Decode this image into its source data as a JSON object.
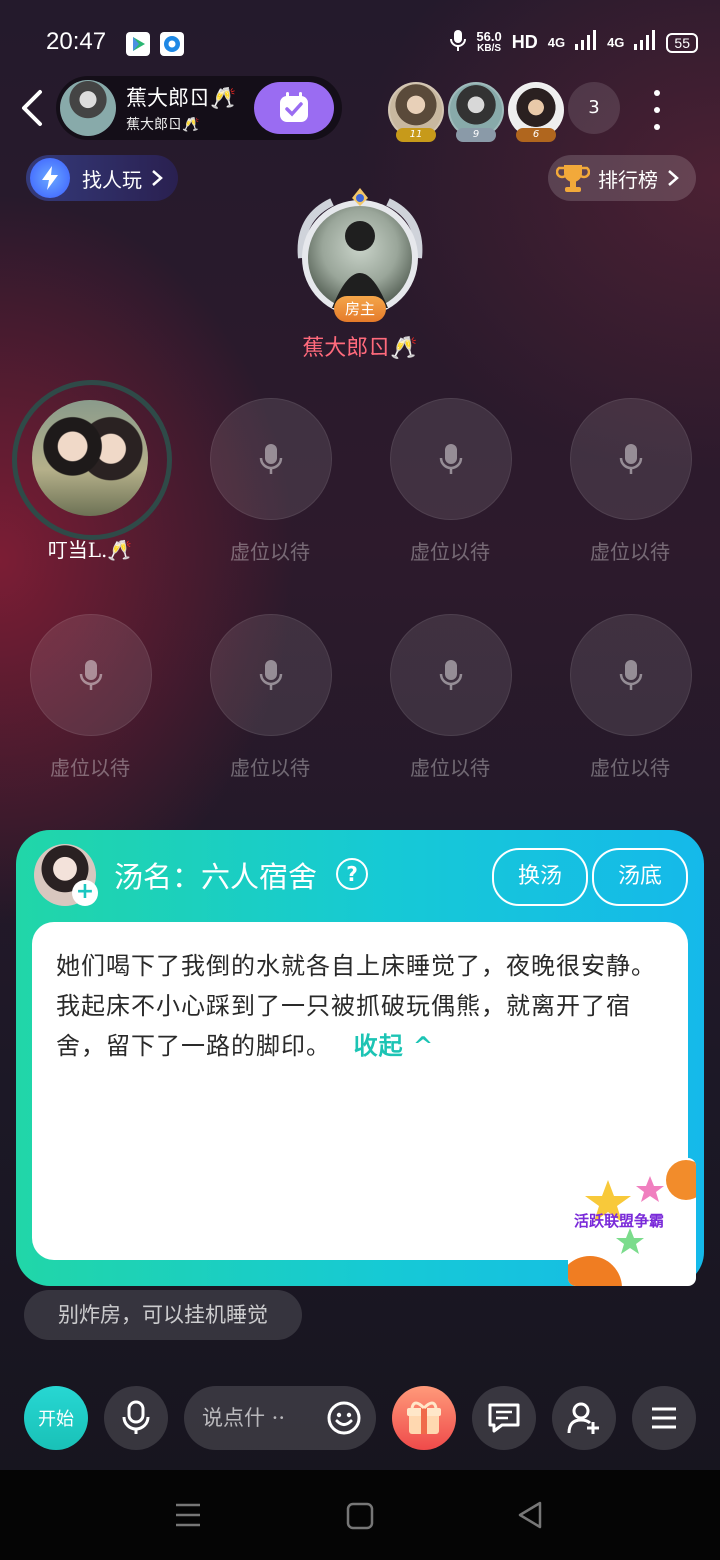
{
  "status_bar": {
    "time": "20:47",
    "net_speed_value": "56.0",
    "net_speed_unit": "KB/S",
    "hd": "HD",
    "network_1": "4G",
    "network_2": "4G",
    "battery": "55",
    "icons": [
      "app-video-icon",
      "app-browser-icon",
      "mic-icon",
      "wifi-icon",
      "signal-icon"
    ]
  },
  "header": {
    "host_name": "蕉大郎ㄖ🥂",
    "host_sub": "蕉大郎ㄖ🥂",
    "audience": [
      {
        "level": "11",
        "badge_color": "#c79a1a"
      },
      {
        "level": "9",
        "badge_color": "#8a9aa8"
      },
      {
        "level": "6",
        "badge_color": "#b0661e"
      }
    ],
    "audience_count": "3",
    "find_play_label": "找人玩",
    "ranking_label": "排行榜"
  },
  "host_seat": {
    "badge": "房主",
    "name": "蕉大郎ㄖ🥂"
  },
  "seats": {
    "occupied_name": "叮当L.🥂",
    "empty_label": "虚位以待"
  },
  "soup": {
    "title": "汤名：六人宿舍",
    "help": "?",
    "change_label": "换汤",
    "answer_label": "汤底",
    "story": "她们喝下了我倒的水就各自上床睡觉了，夜晚很安静。我起床不小心踩到了一只被抓破玩偶熊，就离开了宿舍，留下了一路的脚印。",
    "collapse_label": "收起 ^",
    "plus": "+"
  },
  "promo": {
    "title": "活跃联盟争霸"
  },
  "notice": "别炸房，可以挂机睡觉",
  "toolbar": {
    "start_label": "开始",
    "chat_placeholder": "说点什 ··"
  },
  "colors": {
    "accent_teal": "#1cc4b4",
    "follow_purple": "#9a6cf2",
    "host_name_red": "#ff6a7c"
  }
}
